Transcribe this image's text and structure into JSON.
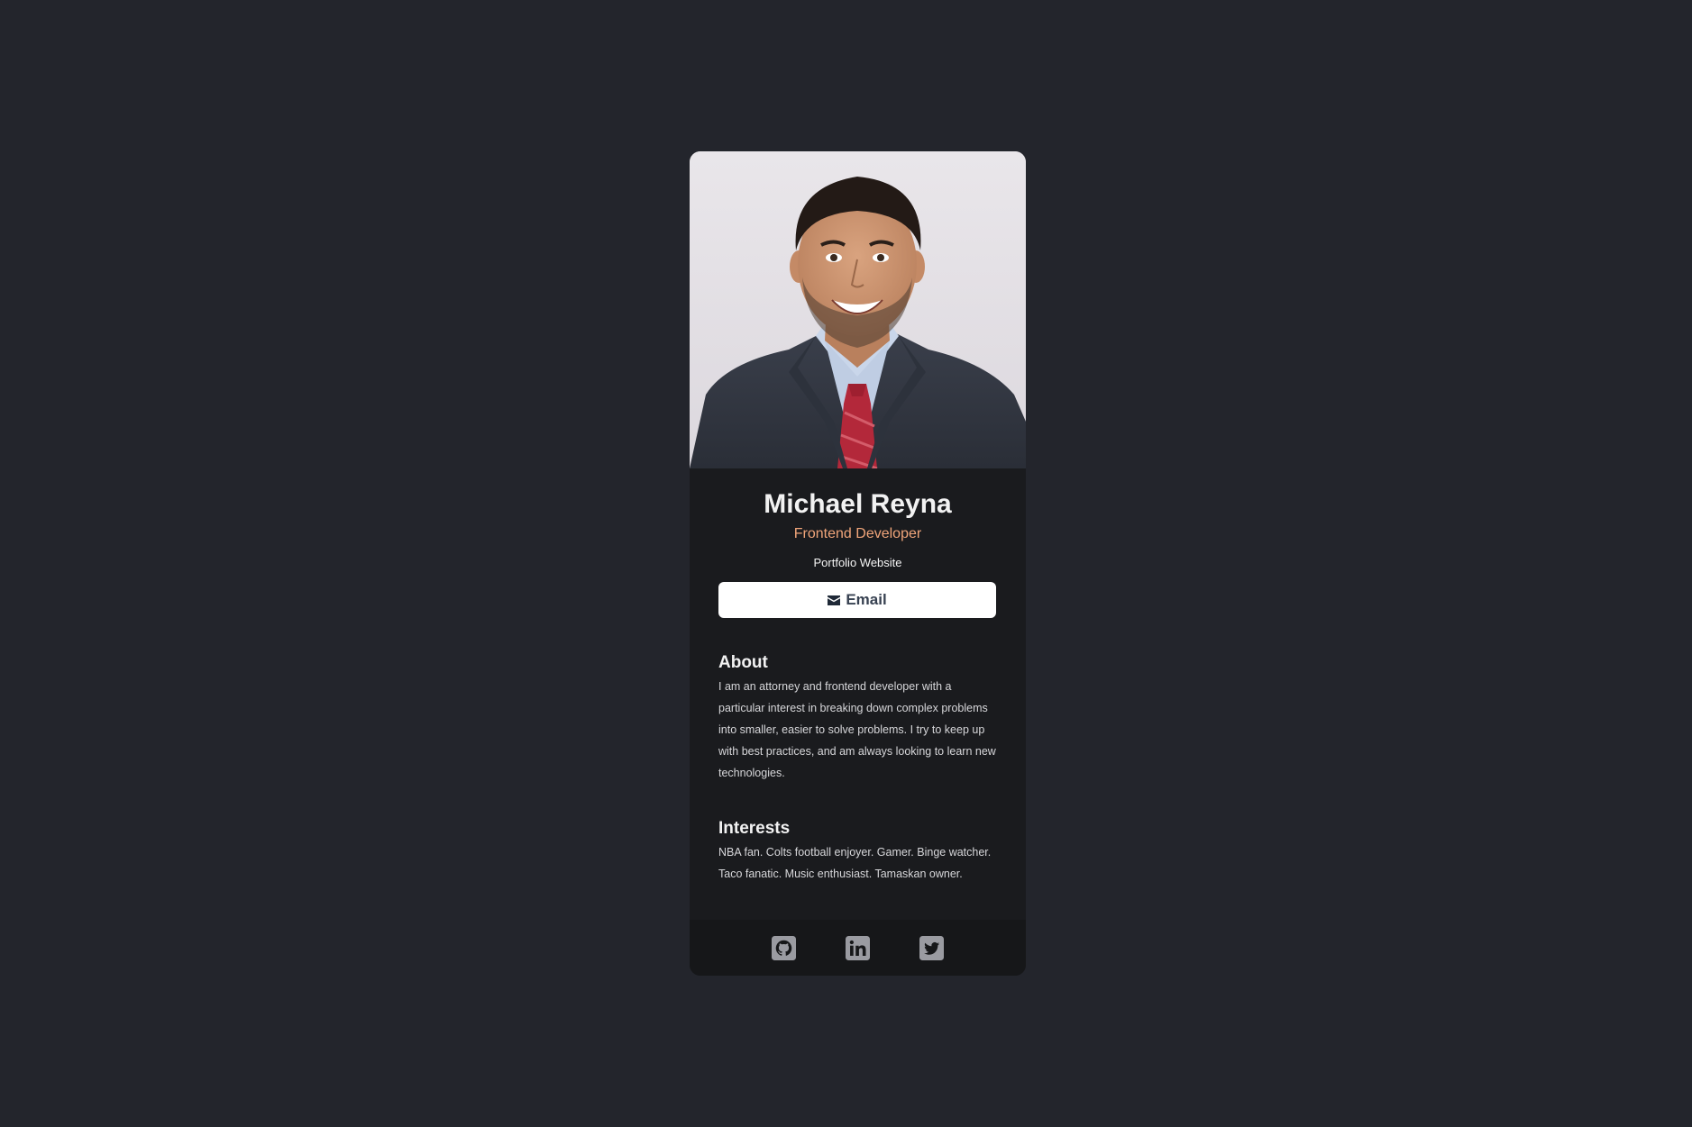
{
  "profile": {
    "name": "Michael Reyna",
    "role": "Frontend Developer",
    "website_label": "Portfolio Website",
    "photo_alt": "Michael Reyna portrait"
  },
  "actions": {
    "email_label": "Email",
    "email_icon": "envelope-icon"
  },
  "about": {
    "heading": "About",
    "text": "I am an attorney and frontend developer with a particular interest in breaking down complex problems into smaller, easier to solve problems. I try to keep up with best practices, and am always looking to learn new technologies."
  },
  "interests": {
    "heading": "Interests",
    "text": "NBA fan. Colts football enjoyer. Gamer. Binge watcher. Taco fanatic. Music enthusiast. Tamaskan owner."
  },
  "footer": {
    "icons": [
      "github-icon",
      "linkedin-icon",
      "twitter-icon"
    ]
  },
  "colors": {
    "page_background": "#23252c",
    "card_background": "#1a1b1e",
    "footer_background": "#161719",
    "accent": "#f0a57a",
    "button_background": "#ffffff",
    "icon_color": "#9a9ba1"
  }
}
